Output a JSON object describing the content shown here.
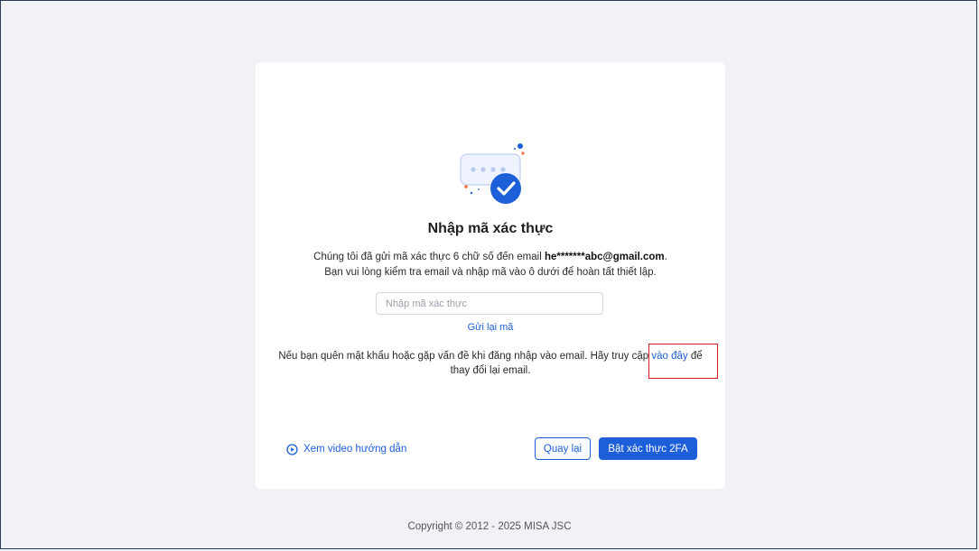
{
  "dialog": {
    "title": "Nhập mã xác thực",
    "desc_line1_prefix": "Chúng tôi đã gửi mã xác thực 6 chữ số đến email ",
    "masked_email": "he*******abc@gmail.com",
    "desc_line1_suffix": ".",
    "desc_line2": "Bạn vui lòng kiểm tra email và nhập mã vào ô dưới để hoàn tất thiết lập.",
    "code_input": {
      "placeholder": "Nhập mã xác thực",
      "value": ""
    },
    "resend_label": "Gửi lại mã",
    "help_prefix": "Nếu bạn quên mật khẩu hoặc gặp vấn đề khi đăng nhập vào email. Hãy truy cập ",
    "help_link": "vào đây",
    "help_suffix": " để thay đổi lại email.",
    "video_link": "Xem video hướng dẫn",
    "back_button": "Quay lại",
    "enable_button": "Bật xác thực 2FA"
  },
  "footer": {
    "copyright": "Copyright © 2012 - 2025 MISA JSC"
  },
  "icons": {
    "illustration": "verified-message-icon",
    "video": "play-circle-icon"
  },
  "colors": {
    "primary": "#1d5fd8",
    "highlight_box": "#e01b1b",
    "page_bg": "#f1f2f6"
  }
}
